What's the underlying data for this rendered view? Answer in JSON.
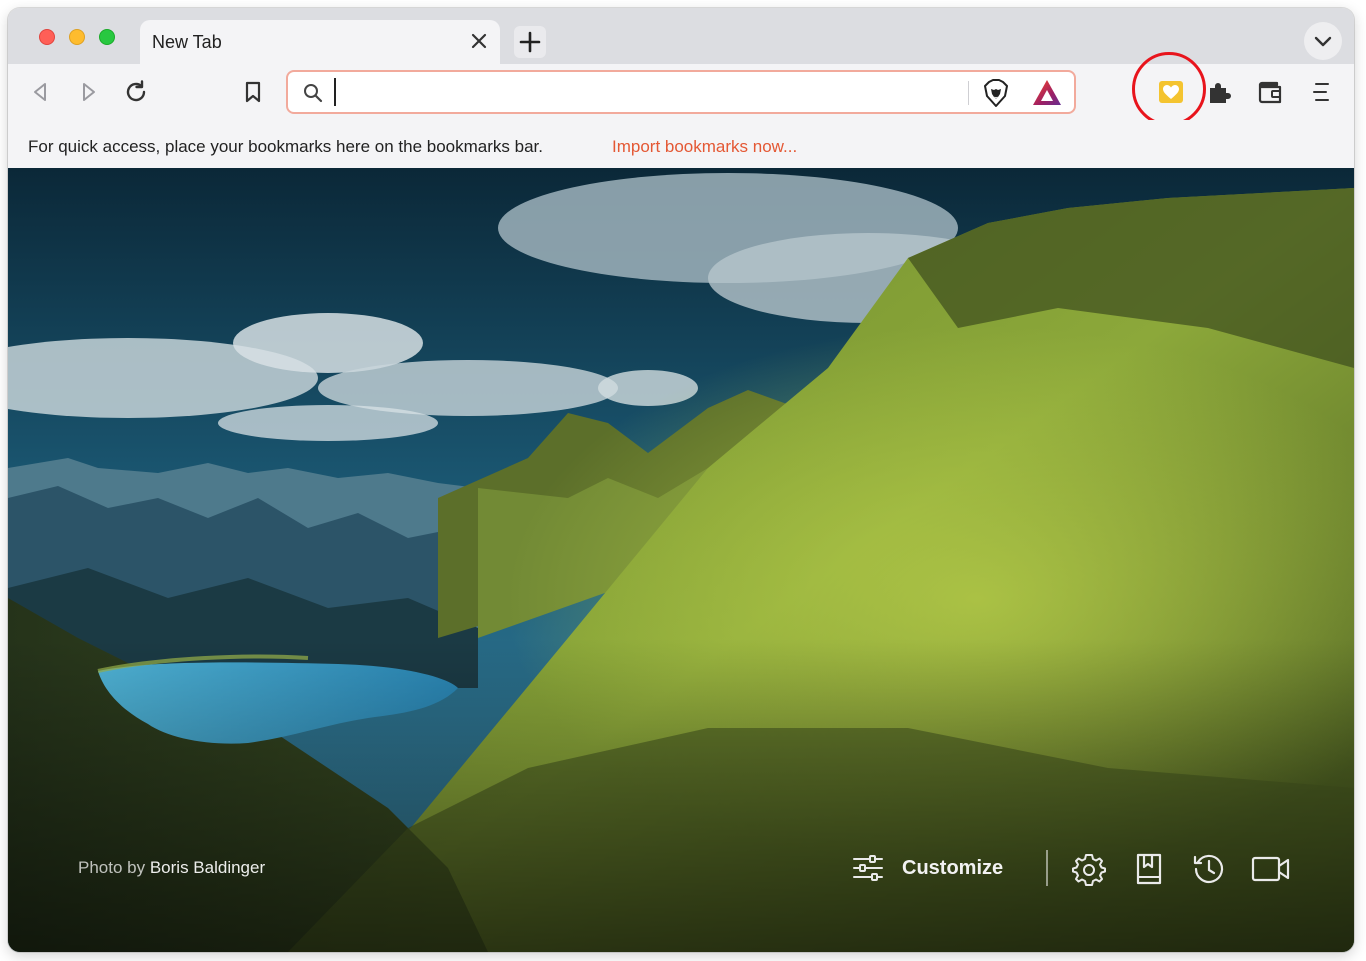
{
  "tab": {
    "title": "New Tab"
  },
  "urlbar": {
    "value": "",
    "placeholder": ""
  },
  "bookmarks_bar": {
    "hint": "For quick access, place your bookmarks here on the bookmarks bar.",
    "import_link": "Import bookmarks now..."
  },
  "ntp": {
    "photo_credit_prefix": "Photo by",
    "photo_credit_author": "Boris Baldinger",
    "customize_label": "Customize"
  },
  "colors": {
    "accent": "#e45834",
    "highlight_ring": "#e8141c",
    "rewards_badge": "#f4c430"
  },
  "icons": [
    "close-icon",
    "plus-icon",
    "chevron-down-icon",
    "back-icon",
    "forward-icon",
    "reload-icon",
    "bookmark-icon",
    "search-icon",
    "brave-shields-icon",
    "brave-rewards-icon",
    "rewards-heart-icon",
    "extensions-icon",
    "wallet-icon",
    "menu-icon",
    "sliders-icon",
    "gear-icon",
    "bookmarks-book-icon",
    "history-icon",
    "video-icon"
  ]
}
